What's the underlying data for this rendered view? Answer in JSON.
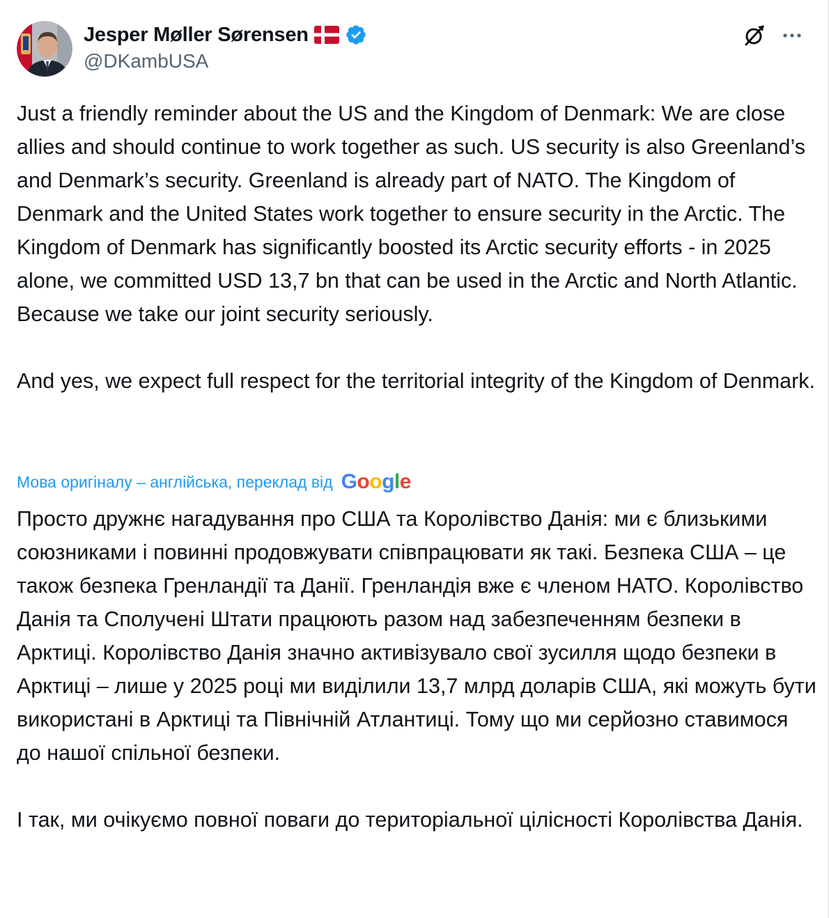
{
  "author": {
    "display_name": "Jesper Møller Sørensen",
    "handle": "@DKambUSA",
    "flag_icon": "denmark-flag-icon",
    "verified_icon": "verified-badge-icon",
    "verified_color": "#1d9bf0"
  },
  "actions": {
    "grok_icon": "grok-icon",
    "more_icon": "more-horizontal-icon"
  },
  "tweet": {
    "text": "Just a friendly reminder about the US and the Kingdom of Denmark: We are close allies and should continue to work together as such. US security is also Greenland’s and Denmark’s security. Greenland is already part of NATO. The Kingdom of Denmark and the United States work together to ensure security in the Arctic. The Kingdom of Denmark has significantly boosted its Arctic security efforts - in 2025 alone, we committed USD 13,7 bn that can be used in the Arctic and North Atlantic. Because we take our joint security seriously.\n\nAnd yes, we expect full respect for the territorial integrity of the Kingdom of Denmark."
  },
  "translation": {
    "note": "Мова оригіналу – англійська, переклад від",
    "provider_logo": "Google",
    "text": "Просто дружнє нагадування про США та Королівство Данія: ми є близькими союзниками і повинні продовжувати співпрацювати як такі. Безпека США – це також безпека Гренландії та Данії. Гренландія вже є членом НАТО. Королівство Данія та Сполучені Штати працюють разом над забезпеченням безпеки в Арктиці. Королівство Данія значно активізувало свої зусилля щодо безпеки в Арктиці – лише у 2025 році ми виділили 13,7 млрд доларів США, які можуть бути використані в Арктиці та Північній Атлантиці. Тому що ми серйозно ставимося до нашої спільної безпеки.\n\nІ так, ми очікуємо повної поваги до територіальної цілісності Королівства Данія."
  },
  "colors": {
    "text": "#0f1419",
    "secondary": "#536471",
    "link": "#1d9bf0"
  }
}
